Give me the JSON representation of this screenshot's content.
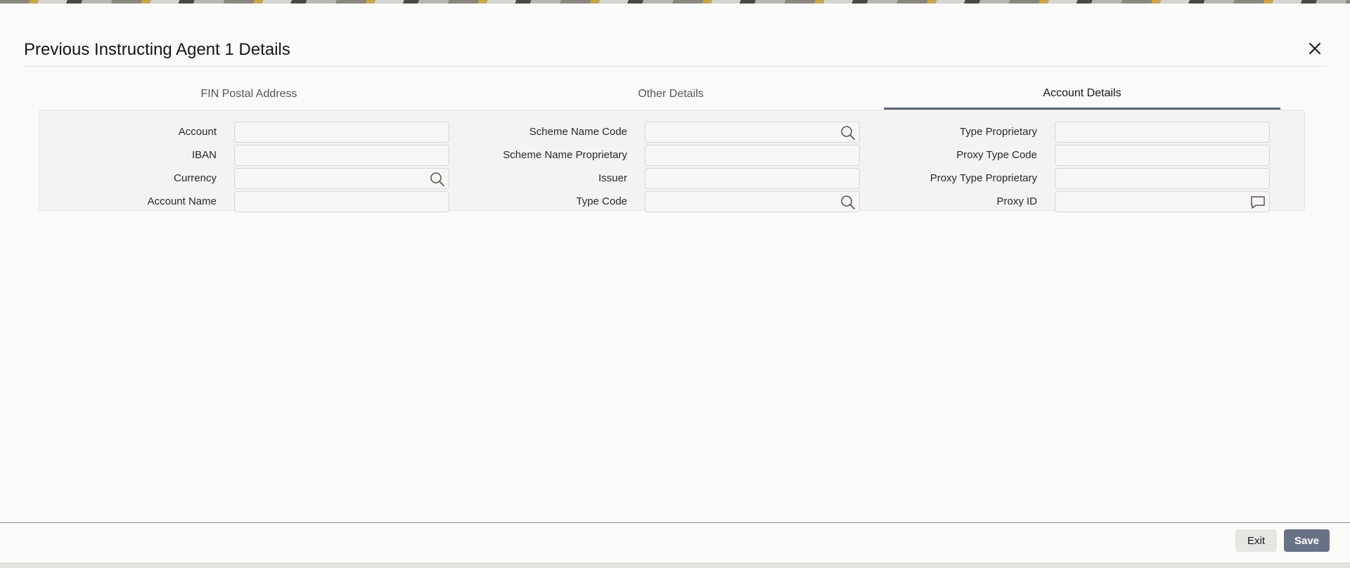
{
  "dialog": {
    "title": "Previous Instructing Agent 1 Details",
    "close_icon": "close-icon"
  },
  "tabs": [
    {
      "label": "FIN Postal Address",
      "active": false
    },
    {
      "label": "Other Details",
      "active": false
    },
    {
      "label": "Account Details",
      "active": true
    }
  ],
  "form": {
    "col1": [
      {
        "label": "Account",
        "value": "",
        "icon": null
      },
      {
        "label": "IBAN",
        "value": "",
        "icon": null
      },
      {
        "label": "Currency",
        "value": "",
        "icon": "search-icon"
      },
      {
        "label": "Account Name",
        "value": "",
        "icon": null
      }
    ],
    "col2": [
      {
        "label": "Scheme Name Code",
        "value": "",
        "icon": "search-icon"
      },
      {
        "label": "Scheme Name Proprietary",
        "value": "",
        "icon": null
      },
      {
        "label": "Issuer",
        "value": "",
        "icon": null
      },
      {
        "label": "Type Code",
        "value": "",
        "icon": "search-icon"
      }
    ],
    "col3": [
      {
        "label": "Type Proprietary",
        "value": "",
        "icon": null
      },
      {
        "label": "Proxy Type Code",
        "value": "",
        "icon": null
      },
      {
        "label": "Proxy Type Proprietary",
        "value": "",
        "icon": null
      },
      {
        "label": "Proxy ID",
        "value": "",
        "icon": "comment-icon"
      }
    ]
  },
  "footer": {
    "exit_label": "Exit",
    "save_label": "Save"
  },
  "colors": {
    "accent": "#5b6579",
    "save_button": "#697185",
    "exit_button": "#e7e6e3"
  }
}
